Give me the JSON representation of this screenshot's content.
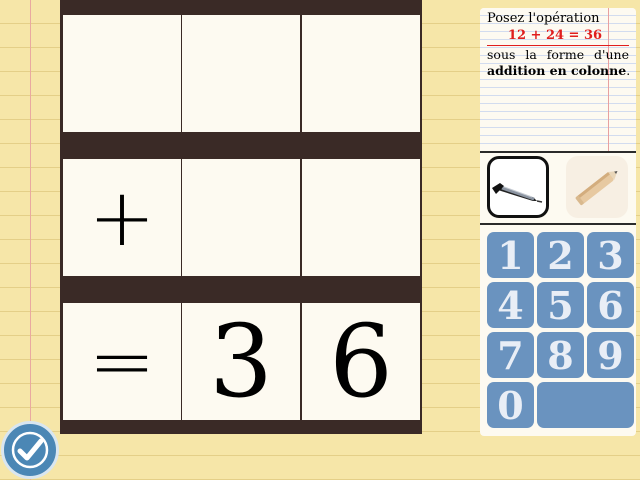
{
  "board": {
    "rows": [
      [
        "",
        "",
        ""
      ],
      [
        "+",
        "",
        ""
      ],
      [
        "=",
        "3",
        "6"
      ]
    ]
  },
  "instructions": {
    "line1": "Posez l'opération",
    "operation": "12 + 24 = 36",
    "line3": "sous la forme d'une",
    "line4_bold": "addition en colonne",
    "line4_end": "."
  },
  "tools": {
    "pen_icon": "pen-icon",
    "pencil_icon": "pencil-icon"
  },
  "keypad": {
    "keys": [
      "1",
      "2",
      "3",
      "4",
      "5",
      "6",
      "7",
      "8",
      "9",
      "0"
    ],
    "blank_key": ""
  },
  "validate_icon": "checkmark-icon",
  "colors": {
    "background": "#f6e6a8",
    "board": "#3a2a26",
    "cell": "#fdfaf1",
    "key": "#6a93bf",
    "operation_red": "#e01e1e",
    "validate": "#4b87b5"
  }
}
